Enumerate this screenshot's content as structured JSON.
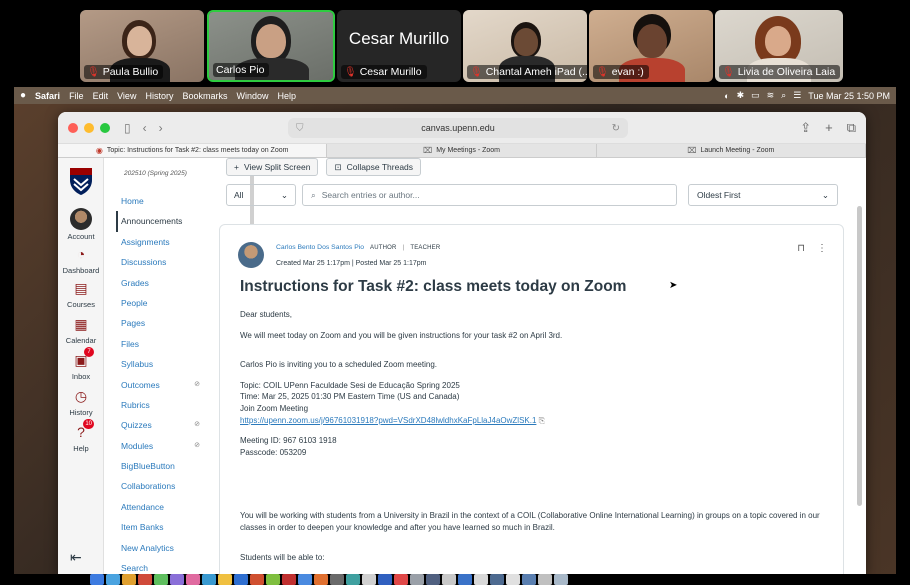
{
  "zoom": {
    "participants": [
      {
        "name": "Paula Bullio",
        "muted": true,
        "skin": "#d8b49a",
        "hair": "#3b2418",
        "shirt": "#1a1a1a",
        "bg": "#a48c7a"
      },
      {
        "name": "Carlos Pio",
        "muted": false,
        "active": true,
        "skin": "#c9a084",
        "hair": "#1e1e1e",
        "shirt": "#2a2a2a",
        "bg": "#7a7f78"
      },
      {
        "name": "Cesar Murillo",
        "muted": true,
        "camera_off": true
      },
      {
        "name": "Chantal Ameh iPad (...",
        "muted": true,
        "skin": "#6b4a35",
        "hair": "#1b1410",
        "shirt": "#2a2a2a",
        "bg": "#d6c9b8"
      },
      {
        "name": "evan :)",
        "muted": true,
        "skin": "#6a4330",
        "hair": "#15100d",
        "shirt": "#b8412f",
        "bg": "#c7a688"
      },
      {
        "name": "Livia de Oliveira Laia",
        "muted": true,
        "skin": "#d9a98a",
        "hair": "#7a3a1c",
        "shirt": "#e8e0d5",
        "bg": "#d7d2c8"
      }
    ]
  },
  "menubar": {
    "apple": "",
    "app": "Safari",
    "items": [
      "File",
      "Edit",
      "View",
      "History",
      "Bookmarks",
      "Window",
      "Help"
    ],
    "datetime": "Tue Mar 25  1:50 PM"
  },
  "browser": {
    "url": "canvas.upenn.edu",
    "tabs": [
      {
        "label": "Topic: Instructions for Task #2: class meets today on Zoom",
        "active": true,
        "icon": "canvas-icon"
      },
      {
        "label": "My Meetings - Zoom",
        "active": false,
        "icon": "zoom-icon"
      },
      {
        "label": "Launch Meeting - Zoom",
        "active": false,
        "icon": "zoom-icon"
      }
    ]
  },
  "global_nav": {
    "items": [
      {
        "label": "Account",
        "icon": "avatar"
      },
      {
        "label": "Dashboard",
        "icon": "dashboard-icon"
      },
      {
        "label": "Courses",
        "icon": "courses-icon"
      },
      {
        "label": "Calendar",
        "icon": "calendar-icon"
      },
      {
        "label": "Inbox",
        "icon": "inbox-icon",
        "badge": "7"
      },
      {
        "label": "History",
        "icon": "history-icon"
      },
      {
        "label": "Help",
        "icon": "help-icon",
        "badge": "10"
      }
    ]
  },
  "course_nav": {
    "term": "202510 (Spring 2025)",
    "items": [
      {
        "label": "Home"
      },
      {
        "label": "Announcements",
        "active": true
      },
      {
        "label": "Assignments"
      },
      {
        "label": "Discussions"
      },
      {
        "label": "Grades"
      },
      {
        "label": "People"
      },
      {
        "label": "Pages"
      },
      {
        "label": "Files"
      },
      {
        "label": "Syllabus"
      },
      {
        "label": "Outcomes",
        "hidden_icon": true
      },
      {
        "label": "Rubrics"
      },
      {
        "label": "Quizzes",
        "hidden_icon": true
      },
      {
        "label": "Modules",
        "hidden_icon": true
      },
      {
        "label": "BigBlueButton"
      },
      {
        "label": "Collaborations"
      },
      {
        "label": "Attendance"
      },
      {
        "label": "Item Banks"
      },
      {
        "label": "New Analytics"
      },
      {
        "label": "Search"
      }
    ]
  },
  "toolbar": {
    "split_label": "View Split Screen",
    "collapse_label": "Collapse Threads"
  },
  "filters": {
    "filter_value": "All",
    "search_placeholder": "Search entries or author...",
    "sort_value": "Oldest First"
  },
  "post": {
    "author": "Carlos Bento Dos Santos Pio",
    "role_author": "AUTHOR",
    "role_teacher": "TEACHER",
    "dates": "Created Mar 25 1:17pm | Posted Mar 25 1:17pm",
    "title": "Instructions for Task #2: class meets today on Zoom",
    "greeting": "Dear students,",
    "para1": "We will meet today on Zoom and you will be given instructions for your task #2 on April 3rd.",
    "invite": "Carlos Pio is inviting you to a scheduled Zoom meeting.",
    "topic": "Topic: COIL UPenn Faculdade Sesi de Educação Spring 2025",
    "time": "Time: Mar 25, 2025 01:30 PM Eastern Time (US and Canada)",
    "join": "Join Zoom Meeting",
    "link": "https://upenn.zoom.us/j/96761031918?pwd=VSdrXD48lwldhxKaFpLlaJ4aOwZlSK.1",
    "meeting_id": "Meeting ID: 967 6103 1918",
    "passcode": "Passcode: 053209",
    "para2": "You will be working with students from a University in Brazil in the context of a COIL (Collaborative Online International Learning) in groups on a topic covered in our classes in order to deepen your knowledge and after you have learned so much in Brazil.",
    "para3": "Students will be able to:"
  },
  "colors": {
    "canvas_link": "#2b7abc",
    "canvas_text": "#2d3b45",
    "penn_red": "#990000",
    "penn_blue": "#011f5b",
    "zoom_active": "#2ecc40",
    "mic_off": "#e0332a"
  }
}
